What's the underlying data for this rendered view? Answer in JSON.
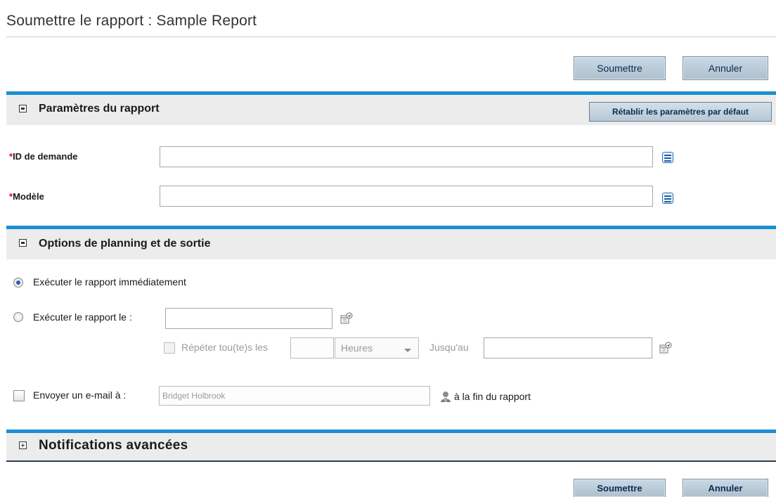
{
  "page": {
    "title": "Soumettre le rapport : Sample Report"
  },
  "toolbar": {
    "submit_label": "Soumettre",
    "cancel_label": "Annuler"
  },
  "report_params": {
    "title": "Paramètres du rapport",
    "reset_label": "Rétablir les paramètres par défaut",
    "required_marker": "*",
    "fields": [
      {
        "label": "ID de demande",
        "value": ""
      },
      {
        "label": "Modèle",
        "value": ""
      }
    ]
  },
  "schedule": {
    "title": "Options de planning et de sortie",
    "run_now_label": "Exécuter le rapport immédiatement",
    "run_now_selected": true,
    "run_on_label": "Exécuter le rapport le :",
    "run_on_value": "",
    "repeat_label": "Répéter tou(te)s les",
    "repeat_value": "",
    "repeat_unit": "Heures",
    "until_label": "Jusqu'au",
    "until_value": "",
    "email_label": "Envoyer un e-mail à :",
    "email_checked": false,
    "email_recipient": "Bridget Holbrook",
    "email_suffix": "à la fin du rapport"
  },
  "notifications": {
    "title": "Notifications avancées",
    "collapsed": true
  },
  "icons": {
    "list": "list-picker-icon",
    "calendar": "calendar-icon",
    "person": "person-icon",
    "collapse": "collapse-minus-icon",
    "expand": "expand-plus-icon"
  },
  "colors": {
    "accent": "#1b8fd2",
    "required": "#d0021b",
    "button_text": "#0b2b52"
  }
}
